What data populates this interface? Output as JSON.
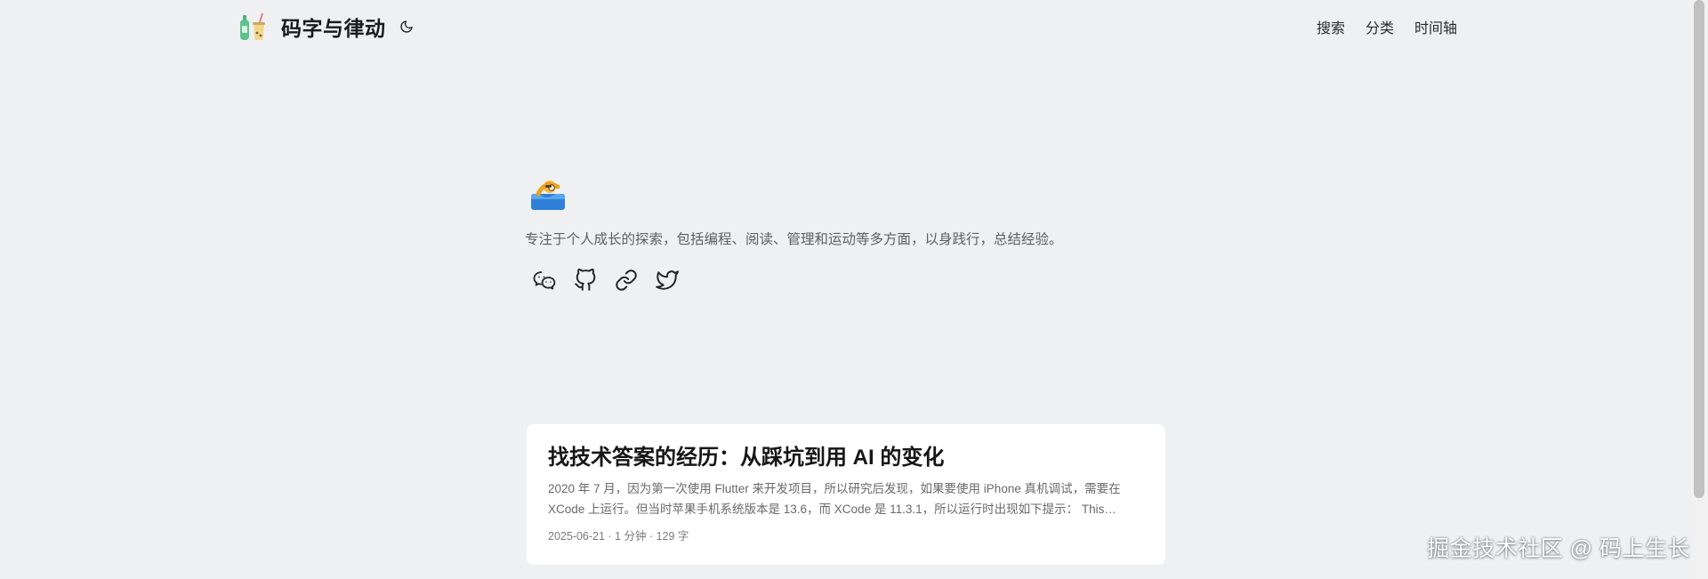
{
  "header": {
    "site_title": "码字与律动",
    "logo_icon": "bottles-logo-icon",
    "theme_toggle_icon": "moon-icon",
    "nav": [
      {
        "label": "搜索"
      },
      {
        "label": "分类"
      },
      {
        "label": "时间轴"
      }
    ]
  },
  "profile": {
    "avatar_icon": "swimmer-emoji-icon",
    "description": "专注于个人成长的探索，包括编程、阅读、管理和运动等多方面，以身践行，总结经验。",
    "social": [
      {
        "icon": "wechat-icon"
      },
      {
        "icon": "github-icon"
      },
      {
        "icon": "link-icon"
      },
      {
        "icon": "twitter-icon"
      }
    ]
  },
  "posts": [
    {
      "title": "找技术答案的经历：从踩坑到用 AI 的变化",
      "excerpt": "2020 年 7 月，因为第一次使用 Flutter 来开发项目，所以研究后发现，如果要使用 iPhone 真机调试，需要在 XCode 上运行。但当时苹果手机系统版本是 13.6，而 XCode 是 11.3.1，所以运行时出现如下提示： This…",
      "meta": "2025-06-21 · 1 分钟 · 129 字"
    }
  ],
  "watermark": "掘金技术社区 @ 码上生长"
}
